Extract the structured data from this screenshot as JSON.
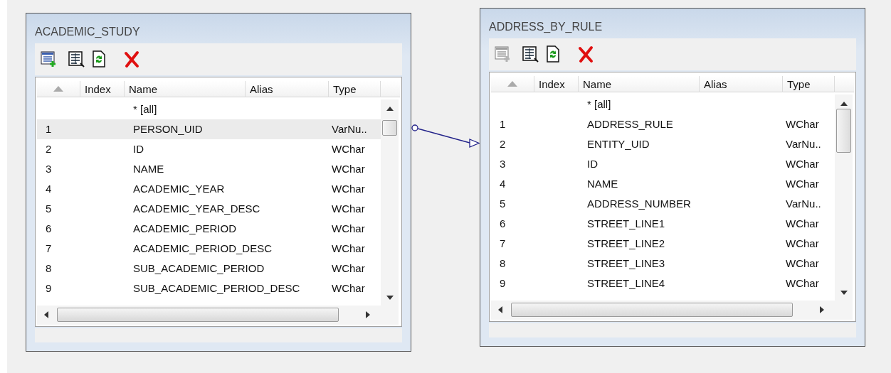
{
  "tables": [
    {
      "title": "ACADEMIC_STUDY",
      "toolbar": [
        {
          "kind": "add-fields",
          "disabled": false
        },
        {
          "kind": "browse",
          "disabled": false
        },
        {
          "kind": "refresh",
          "disabled": false
        },
        {
          "kind": "delete",
          "disabled": false
        }
      ],
      "columns": [
        "Index",
        "Name",
        "Alias",
        "Type"
      ],
      "rows": [
        {
          "index": "",
          "name": "* [all]",
          "type": "",
          "selected": false
        },
        {
          "index": "1",
          "name": "PERSON_UID",
          "type": "VarNu..",
          "selected": true
        },
        {
          "index": "2",
          "name": "ID",
          "type": "WChar",
          "selected": false
        },
        {
          "index": "3",
          "name": "NAME",
          "type": "WChar",
          "selected": false
        },
        {
          "index": "4",
          "name": "ACADEMIC_YEAR",
          "type": "WChar",
          "selected": false
        },
        {
          "index": "5",
          "name": "ACADEMIC_YEAR_DESC",
          "type": "WChar",
          "selected": false
        },
        {
          "index": "6",
          "name": "ACADEMIC_PERIOD",
          "type": "WChar",
          "selected": false
        },
        {
          "index": "7",
          "name": "ACADEMIC_PERIOD_DESC",
          "type": "WChar",
          "selected": false
        },
        {
          "index": "8",
          "name": "SUB_ACADEMIC_PERIOD",
          "type": "WChar",
          "selected": false
        },
        {
          "index": "9",
          "name": "SUB_ACADEMIC_PERIOD_DESC",
          "type": "WChar",
          "selected": false
        }
      ]
    },
    {
      "title": "ADDRESS_BY_RULE",
      "toolbar": [
        {
          "kind": "add-fields",
          "disabled": true
        },
        {
          "kind": "browse",
          "disabled": false
        },
        {
          "kind": "refresh",
          "disabled": false
        },
        {
          "kind": "delete",
          "disabled": false
        }
      ],
      "columns": [
        "Index",
        "Name",
        "Alias",
        "Type"
      ],
      "rows": [
        {
          "index": "",
          "name": "* [all]",
          "type": "",
          "selected": false
        },
        {
          "index": "1",
          "name": "ADDRESS_RULE",
          "type": "WChar",
          "selected": false
        },
        {
          "index": "2",
          "name": "ENTITY_UID",
          "type": "VarNu..",
          "selected": false
        },
        {
          "index": "3",
          "name": "ID",
          "type": "WChar",
          "selected": false
        },
        {
          "index": "4",
          "name": "NAME",
          "type": "WChar",
          "selected": false
        },
        {
          "index": "5",
          "name": "ADDRESS_NUMBER",
          "type": "VarNu..",
          "selected": false
        },
        {
          "index": "6",
          "name": "STREET_LINE1",
          "type": "WChar",
          "selected": false
        },
        {
          "index": "7",
          "name": "STREET_LINE2",
          "type": "WChar",
          "selected": false
        },
        {
          "index": "8",
          "name": "STREET_LINE3",
          "type": "WChar",
          "selected": false
        },
        {
          "index": "9",
          "name": "STREET_LINE4",
          "type": "WChar",
          "selected": false
        }
      ]
    }
  ]
}
